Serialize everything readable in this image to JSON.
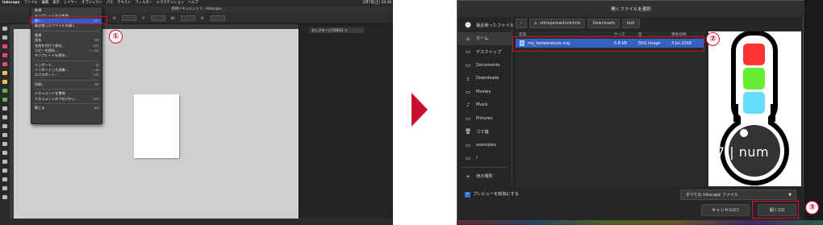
{
  "left": {
    "menubar": {
      "app": "Inkscape",
      "items": [
        "ファイル",
        "編集",
        "表示",
        "レイヤー",
        "オブジェクト",
        "パス",
        "テキスト",
        "フィルター",
        "エクステンション",
        "ヘルプ"
      ],
      "clock": "2月7日(土) 10:36"
    },
    "window_title": "新規ドキュメント 1 - Inkscape",
    "toolbar": [
      "X:",
      "Y:",
      "W:",
      "H:"
    ],
    "panel_tab": "セレクターとCSS(S)",
    "file_menu": {
      "items": [
        {
          "label": "新規",
          "shortcut": ""
        },
        {
          "label": "テンプレートから新規...",
          "shortcut": ""
        },
        {
          "label": "開く...",
          "shortcut": "⌘O",
          "highlighted": true
        },
        {
          "label": "最近使ったファイルを開く",
          "shortcut": ""
        },
        {
          "sep": true
        },
        {
          "label": "復帰",
          "shortcut": ""
        },
        {
          "label": "保存",
          "shortcut": "⌘S"
        },
        {
          "label": "名前を付けて保存...",
          "shortcut": "⇧⌘S"
        },
        {
          "label": "コピーを保存...",
          "shortcut": "⇧⌥⌘S"
        },
        {
          "label": "テンプレートを保存...",
          "shortcut": ""
        },
        {
          "sep": true
        },
        {
          "label": "インポート...",
          "shortcut": "⌘I"
        },
        {
          "label": "インポートした画像...",
          "shortcut": "⌥⌘I"
        },
        {
          "label": "エクスポート...",
          "shortcut": "⇧⌘E"
        },
        {
          "sep": true
        },
        {
          "label": "印刷...",
          "shortcut": "⌘P"
        },
        {
          "sep": true
        },
        {
          "label": "ドキュメントを整理",
          "shortcut": ""
        },
        {
          "label": "ドキュメントのプロパティ...",
          "shortcut": "⇧⌘D"
        },
        {
          "sep": true
        },
        {
          "label": "閉じる",
          "shortcut": "⌘W"
        }
      ]
    },
    "badge": "①"
  },
  "right": {
    "dialog_title": "開くファイルを選択",
    "sidebar": [
      {
        "icon": "🕒",
        "label": "最近使ったファイル"
      },
      {
        "icon": "⌂",
        "label": "ホーム"
      },
      {
        "icon": "▭",
        "label": "デスクトップ"
      },
      {
        "icon": "▭",
        "label": "Documents"
      },
      {
        "icon": "⤓",
        "label": "Downloads"
      },
      {
        "icon": "▭",
        "label": "Movies"
      },
      {
        "icon": "♪",
        "label": "Music"
      },
      {
        "icon": "▭",
        "label": "Pictures"
      },
      {
        "icon": "🗑",
        "label": "ゴミ箱"
      },
      {
        "icon": "▭",
        "label": "examples"
      },
      {
        "icon": "▭",
        "label": "/"
      },
      {
        "icon": "+",
        "label": "他の場所"
      }
    ],
    "path": [
      "shirayamashinichiro",
      "Downloads",
      "test"
    ],
    "columns": {
      "name": "名前",
      "size": "サイズ",
      "type": "型",
      "modified": "更新日時"
    },
    "file": {
      "name": "my_temperature.svg",
      "size": "5.8 kB",
      "type": "SVG image",
      "modified": "3 Jul 2018"
    },
    "preview_text": "7 | num",
    "preview_checkbox": "プレビューを有効にする",
    "filter": "すべての Inkscape ファイル",
    "cancel_label": "キャンセル(C)",
    "open_label": "開く(O)",
    "badges": [
      "②",
      "③"
    ]
  }
}
